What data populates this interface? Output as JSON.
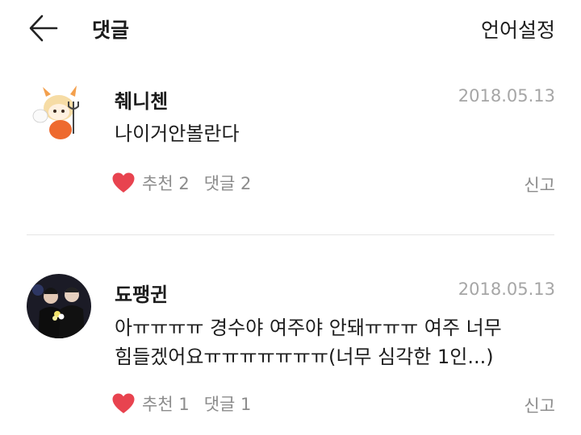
{
  "header": {
    "title": "댓글",
    "language_label": "언어설정"
  },
  "colors": {
    "heart": "#e8434f",
    "muted": "#8c8c8c",
    "date": "#a6a6a6"
  },
  "comments": [
    {
      "author": "췌니첸",
      "date": "2018.05.13",
      "lines": [
        "나이거안볼란다"
      ],
      "likes_label": "추천 2",
      "replies_label": "댓글 2",
      "report_label": "신고"
    },
    {
      "author": "됴팽귄",
      "date": "2018.05.13",
      "lines": [
        "아ㅠㅠㅠㅠ 경수야 여주야 안돼ㅠㅠㅠ 여주 너무",
        "힘들겠어요ㅠㅠㅠㅠㅠㅠㅠ(너무 심각한 1인...)"
      ],
      "likes_label": "추천 1",
      "replies_label": "댓글 1",
      "report_label": "신고"
    }
  ]
}
